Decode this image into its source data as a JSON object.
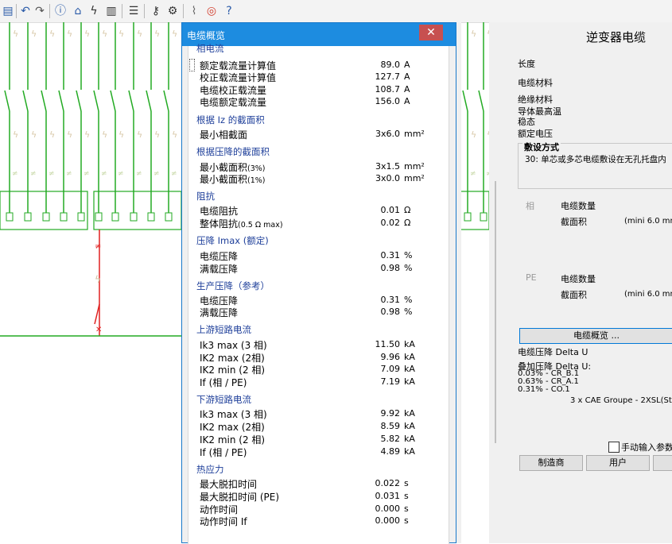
{
  "toolbar": {
    "icons": [
      "document-icon",
      "undo-icon",
      "redo-icon",
      "info-icon",
      "home-icon",
      "lightning-icon",
      "bar-chart-icon",
      "database-icon",
      "key-icon",
      "gear-icon",
      "chart-line-icon",
      "lifebuoy-icon",
      "help-icon"
    ]
  },
  "right_panel": {
    "title": "逆变器电缆",
    "length_label": "长度",
    "cable_material_label": "电缆材料",
    "insulation_label": "绝缘材料",
    "max_temp_label": "导体最高温",
    "steady_label": "稳态",
    "rated_voltage_label": "额定电压",
    "laying_title": "敷设方式",
    "laying_value": "30: 单芯或多芯电缆敷设在无孔托盘内",
    "phase_label": "相",
    "phase_cable_count": "电缆数量",
    "phase_section": "截面积",
    "phase_min": "(mini 6.0 mm",
    "pe_label": "PE",
    "pe_cable_count": "电缆数量",
    "pe_section": "截面积",
    "pe_min": "(mini 6.0 mm",
    "overview_button": "电缆概览 ...",
    "voltage_drop_label": "电缆压降 Delta U",
    "added_drop_label": "叠加压降 Delta U:",
    "drop_lines": [
      "0.03% - CR_B.1",
      "0.63% - CR_A.1",
      "0.31% - CO.1"
    ],
    "cable_ref": "3 x CAE Groupe - 2XSL(St)C",
    "manual_checkbox": "手动输入参数",
    "manufacturer_button": "制造商",
    "user_button": "用户"
  },
  "dialog": {
    "title": "电缆概览",
    "close": "✕",
    "sections": [
      {
        "title": "相电流",
        "rows": [
          {
            "label": "额定载流量计算值",
            "value": "89.0",
            "unit": "A"
          },
          {
            "label": "校正载流量计算值",
            "value": "127.7",
            "unit": "A"
          },
          {
            "label": "电缆校正载流量",
            "value": "108.7",
            "unit": "A"
          },
          {
            "label": "电缆额定载流量",
            "value": "156.0",
            "unit": "A"
          }
        ]
      },
      {
        "title": "根据 Iz 的截面积",
        "rows": [
          {
            "label": "最小相截面",
            "value": "3x6.0",
            "unit": "mm²"
          }
        ]
      },
      {
        "title": "根据压降的截面积",
        "rows": [
          {
            "label": "最小截面积",
            "small": "(3%)",
            "value": "3x1.5",
            "unit": "mm²"
          },
          {
            "label": "最小截面积",
            "small": "(1%)",
            "value": "3x0.0",
            "unit": "mm²"
          }
        ]
      },
      {
        "title": "阻抗",
        "rows": [
          {
            "label": "电缆阻抗",
            "value": "0.01",
            "unit": "Ω"
          },
          {
            "label": "整体阻抗",
            "small": "(0.5 Ω max)",
            "value": "0.02",
            "unit": "Ω"
          }
        ]
      },
      {
        "title": "压降 Imax (额定)",
        "rows": [
          {
            "label": "电缆压降",
            "value": "0.31",
            "unit": "%"
          },
          {
            "label": "满载压降",
            "value": "0.98",
            "unit": "%"
          }
        ]
      },
      {
        "title": "生产压降（参考）",
        "rows": [
          {
            "label": "电缆压降",
            "value": "0.31",
            "unit": "%"
          },
          {
            "label": "满载压降",
            "value": "0.98",
            "unit": "%"
          }
        ]
      },
      {
        "title": "上游短路电流",
        "rows": [
          {
            "label": "Ik3 max (3 相)",
            "value": "11.50",
            "unit": "kA"
          },
          {
            "label": "IK2 max (2相)",
            "value": "9.96",
            "unit": "kA"
          },
          {
            "label": "IK2 min (2 相)",
            "value": "7.09",
            "unit": "kA"
          },
          {
            "label": "If (相 / PE)",
            "value": "7.19",
            "unit": "kA"
          }
        ]
      },
      {
        "title": "下游短路电流",
        "rows": [
          {
            "label": "Ik3 max (3 相)",
            "value": "9.92",
            "unit": "kA"
          },
          {
            "label": "IK2 max (2相)",
            "value": "8.59",
            "unit": "kA"
          },
          {
            "label": "IK2 min (2 相)",
            "value": "5.82",
            "unit": "kA"
          },
          {
            "label": "If (相 / PE)",
            "value": "4.89",
            "unit": "kA"
          }
        ]
      },
      {
        "title": "热应力",
        "rows": [
          {
            "label": "最大脱扣时间",
            "value": "0.022",
            "unit": "s"
          },
          {
            "label": "最大脱扣时间 (PE)",
            "value": "0.031",
            "unit": "s"
          },
          {
            "label": "动作时间",
            "value": "0.000",
            "unit": "s"
          },
          {
            "label": "动作时间 If",
            "value": "0.000",
            "unit": "s"
          }
        ]
      }
    ]
  }
}
